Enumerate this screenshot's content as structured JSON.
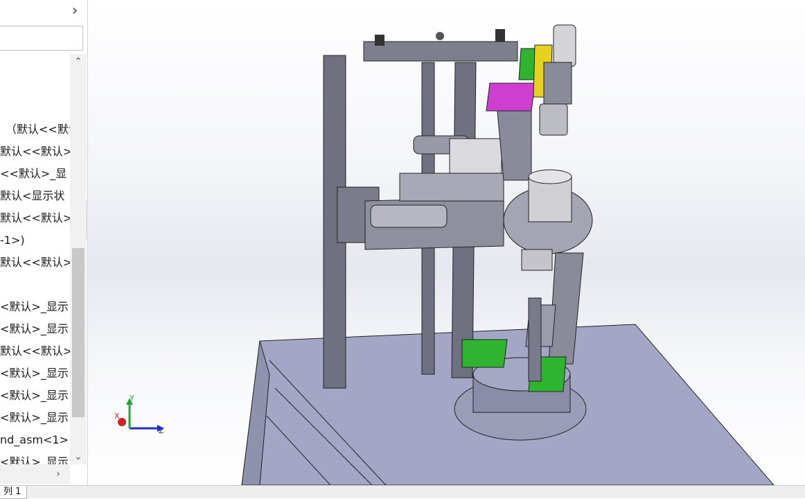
{
  "feature_tree": {
    "rows": [
      "（默认<<默认",
      "默认<<默认>_",
      "<<默认>_显",
      "默认<显示状",
      "默认<<默认>_",
      "-1>)",
      "默认<<默认>_",
      "",
      "<默认>_显示",
      "<默认>_显示",
      "默认<<默认>_",
      "<默认>_显示",
      "<默认>_显示",
      "<默认>_显示",
      "nd_asm<1>",
      "<默认>_显示"
    ]
  },
  "viewport": {
    "triad": {
      "x_label": "X",
      "y_label": "Y",
      "z_label": "Z"
    },
    "colors": {
      "part_gray": "#8c8d9a",
      "plate_blue": "#a3a6c4",
      "green": "#2fb42f",
      "magenta": "#cc3fd1",
      "yellow": "#e6d21e"
    }
  },
  "bottom_tab": {
    "label": "列 1"
  },
  "icons": {
    "expand": "chevron-right-icon",
    "scroll_up": "chevron-up-icon",
    "scroll_down": "chevron-down-icon",
    "scroll_right": "chevron-right-icon"
  }
}
